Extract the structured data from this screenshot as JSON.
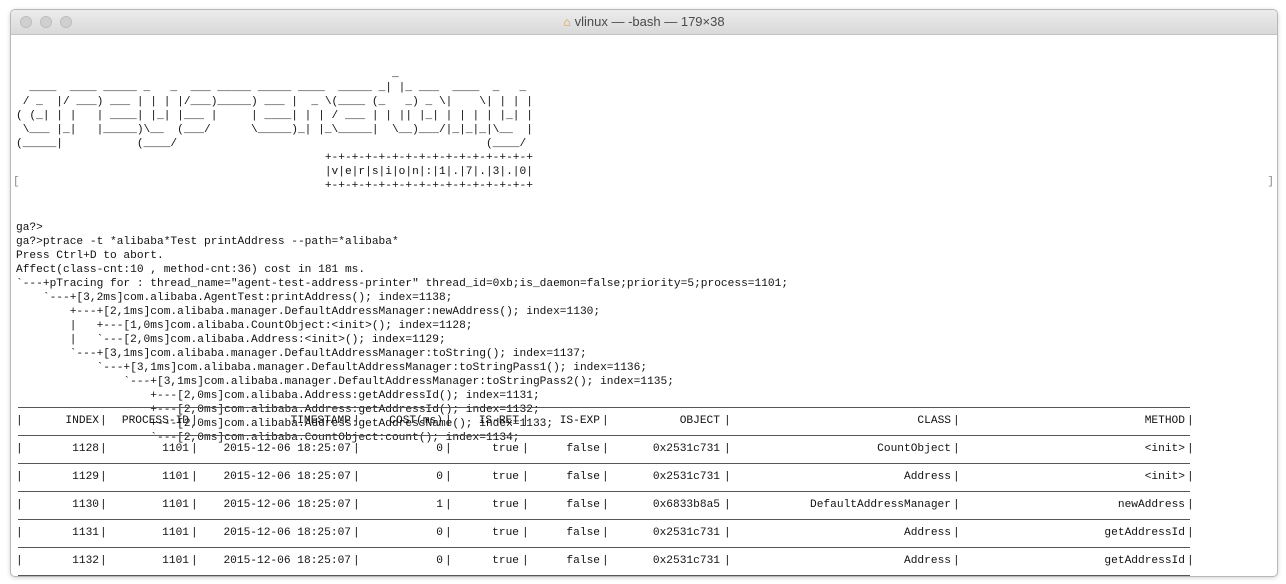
{
  "window": {
    "title": "vlinux — -bash — 179×38"
  },
  "banner": [
    "                                                        _",
    "  ____  ____ _____ _   _  ___ _____ _____ ____  _____ _| |_ ___  ____  _   _",
    " / _  |/ ___) ___ | | | |/___)_____) ___ |  _ \\(____ (_   _) _ \\|    \\| | | |",
    "( (_| | |   | ____| |_| |___ |     | ____| | | / ___ | | || |_| | | | | |_| |",
    " \\___ |_|   |_____)\\__  (___/      \\_____)_| |_\\_____|  \\__)___/|_|_|_|\\__  |",
    "(_____|           (____/                                              (____/",
    "                                              +-+-+-+-+-+-+-+-+-+-+-+-+-+-+-+",
    "                                              |v|e|r|s|i|o|n|:|1|.|7|.|3|.|0|",
    "                                              +-+-+-+-+-+-+-+-+-+-+-+-+-+-+-+"
  ],
  "console": [
    "ga?>",
    "ga?>ptrace -t *alibaba*Test printAddress --path=*alibaba*",
    "Press Ctrl+D to abort.",
    "Affect(class-cnt:10 , method-cnt:36) cost in 181 ms.",
    "`---+pTracing for : thread_name=\"agent-test-address-printer\" thread_id=0xb;is_daemon=false;priority=5;process=1101;",
    "    `---+[3,2ms]com.alibaba.AgentTest:printAddress(); index=1138;",
    "        +---+[2,1ms]com.alibaba.manager.DefaultAddressManager:newAddress(); index=1130;",
    "        |   +---[1,0ms]com.alibaba.CountObject:<init>(); index=1128;",
    "        |   `---[2,0ms]com.alibaba.Address:<init>(); index=1129;",
    "        `---+[3,1ms]com.alibaba.manager.DefaultAddressManager:toString(); index=1137;",
    "            `---+[3,1ms]com.alibaba.manager.DefaultAddressManager:toStringPass1(); index=1136;",
    "                `---+[3,1ms]com.alibaba.manager.DefaultAddressManager:toStringPass2(); index=1135;",
    "                    +---[2,0ms]com.alibaba.Address:getAddressId(); index=1131;",
    "                    +---[2,0ms]com.alibaba.Address:getAddressId(); index=1132;",
    "                    +---[2,0ms]com.alibaba.Address:getAddressName(); index=1133;",
    "                    `---[2,0ms]com.alibaba.CountObject:count(); index=1134;"
  ],
  "table": {
    "headers": [
      "INDEX",
      "PROCESS-ID",
      "TIMESTAMP",
      "COST(ms)",
      "IS-RET",
      "IS-EXP",
      "OBJECT",
      "CLASS",
      "METHOD"
    ],
    "rows": [
      [
        "1128",
        "1101",
        "2015-12-06 18:25:07",
        "0",
        "true",
        "false",
        "0x2531c731",
        "CountObject",
        "<init>"
      ],
      [
        "1129",
        "1101",
        "2015-12-06 18:25:07",
        "0",
        "true",
        "false",
        "0x2531c731",
        "Address",
        "<init>"
      ],
      [
        "1130",
        "1101",
        "2015-12-06 18:25:07",
        "1",
        "true",
        "false",
        "0x6833b8a5",
        "DefaultAddressManager",
        "newAddress"
      ],
      [
        "1131",
        "1101",
        "2015-12-06 18:25:07",
        "0",
        "true",
        "false",
        "0x2531c731",
        "Address",
        "getAddressId"
      ],
      [
        "1132",
        "1101",
        "2015-12-06 18:25:07",
        "0",
        "true",
        "false",
        "0x2531c731",
        "Address",
        "getAddressId"
      ]
    ]
  },
  "colors": {
    "text": "#111111",
    "titlebar": "#e2e2e2",
    "home_icon": "#d99a3c"
  },
  "icons": {
    "home": "home-icon"
  }
}
